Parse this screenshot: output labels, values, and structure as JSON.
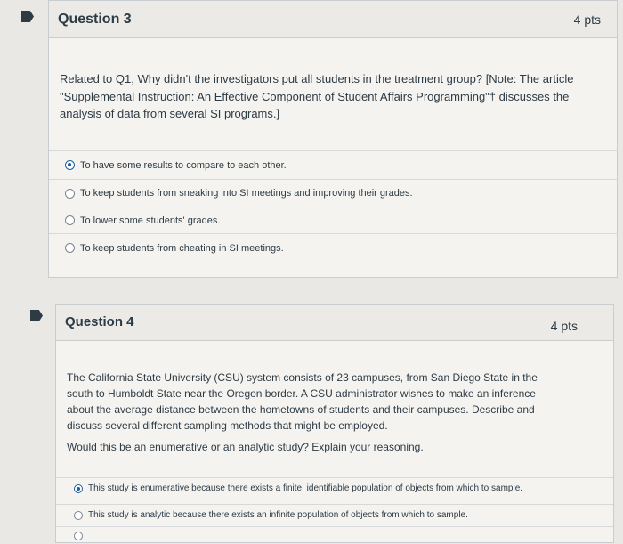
{
  "question3": {
    "title": "Question 3",
    "points": "4 pts",
    "text": "Related to Q1, Why didn't the investigators put all students in the treatment group? [Note: The article \"Supplemental Instruction: An Effective Component of Student Affairs Programming\"† discusses the analysis of data from several SI programs.]",
    "answers": [
      {
        "label": "To have some results to compare to each other.",
        "selected": true
      },
      {
        "label": "To keep students from sneaking into SI meetings and improving their grades.",
        "selected": false
      },
      {
        "label": "To lower some students' grades.",
        "selected": false
      },
      {
        "label": "To keep students from cheating in SI meetings.",
        "selected": false
      }
    ]
  },
  "question4": {
    "title": "Question 4",
    "points": "4 pts",
    "text": "The California State University (CSU) system consists of 23 campuses, from San Diego State in the south to Humboldt State near the Oregon border. A CSU administrator wishes to make an inference about the average distance between the hometowns of students and their campuses. Describe and discuss several different sampling methods that might be employed.",
    "text2": "Would this be an enumerative or an analytic study? Explain your reasoning.",
    "answers": [
      {
        "label": "This study is enumerative because there exists a finite, identifiable population of objects from which to sample.",
        "selected": true
      },
      {
        "label": "This study is analytic because there exists an infinite population of objects from which to sample.",
        "selected": false
      },
      {
        "label": "",
        "selected": false
      }
    ]
  },
  "colors": {
    "accent": "#1a5fa0",
    "text": "#2d3b45",
    "flag": "#2d3b45"
  }
}
